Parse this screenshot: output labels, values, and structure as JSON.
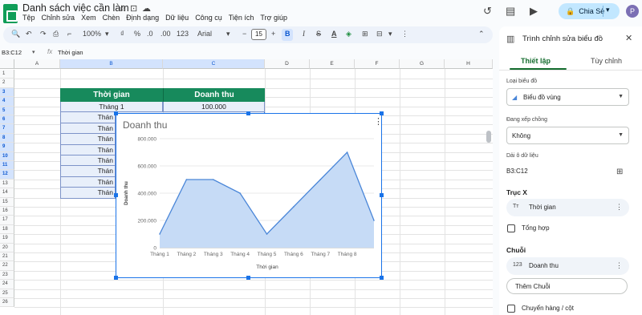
{
  "app": {
    "title": "Danh sách việc cần làm",
    "menu": [
      "Tệp",
      "Chỉnh sửa",
      "Xem",
      "Chèn",
      "Định dạng",
      "Dữ liệu",
      "Công cụ",
      "Tiện ích",
      "Trợ giúp"
    ],
    "share_label": "Chia Sẻ",
    "avatar_initial": "P"
  },
  "toolbar": {
    "zoom": "100%",
    "currency": "₫",
    "percent": "%",
    "decrease_decimal": ".0",
    "increase_decimal": ".00",
    "number_format": "123",
    "font": "Arial",
    "font_size": "15",
    "bold": "B",
    "italic": "I"
  },
  "formula_bar": {
    "name_box": "B3:C12",
    "fx": "fx",
    "value": "Thời gian"
  },
  "sheet": {
    "columns": [
      "A",
      "B",
      "C",
      "D",
      "E",
      "F",
      "G",
      "H"
    ],
    "rows": [
      "1",
      "2",
      "3",
      "4",
      "5",
      "6",
      "7",
      "8",
      "9",
      "10",
      "11",
      "12",
      "13",
      "14",
      "15",
      "16",
      "17",
      "18",
      "19",
      "20",
      "21",
      "22",
      "23",
      "24",
      "25",
      "26"
    ],
    "table_header": [
      "Thời gian",
      "Doanh thu"
    ],
    "visible_cells": {
      "b4": "Tháng 1",
      "c4": "100.000",
      "b5": "Thán",
      "b6": "Thán",
      "b7": "Thán",
      "b8": "Thán",
      "b9": "Thán",
      "b10": "Thán",
      "b11": "Thán",
      "b12": "Thán"
    }
  },
  "chart_data": {
    "type": "area",
    "title": "Doanh thu",
    "xlabel": "Thời gian",
    "ylabel": "Doanh thu",
    "categories": [
      "Tháng 1",
      "Tháng 2",
      "Tháng 3",
      "Tháng 4",
      "Tháng 5",
      "Tháng 6",
      "Tháng 7",
      "Tháng 8"
    ],
    "x_tick_labels": [
      "Tháng 1",
      "Tháng 2",
      "Tháng 3",
      "Tháng 4",
      "Tháng 5",
      "Tháng 6",
      "Tháng 7",
      "Tháng 8"
    ],
    "values": [
      100000,
      500000,
      500000,
      400000,
      100000,
      300000,
      500000,
      700000,
      200000
    ],
    "ylim": [
      0,
      800000
    ],
    "y_ticks": [
      0,
      200000,
      400000,
      600000,
      800000
    ],
    "y_tick_labels": [
      "0",
      "200.000",
      "400.000",
      "600.000",
      "800.000"
    ],
    "grid": true,
    "legend": "none",
    "fill_color": "#c6dbf6",
    "line_color": "#4a86d8"
  },
  "panel": {
    "title": "Trình chỉnh sửa biểu đồ",
    "tab_setup": "Thiết lập",
    "tab_customize": "Tùy chỉnh",
    "chart_type_label": "Loại biểu đồ",
    "chart_type_value": "Biểu đồ vùng",
    "stacking_label": "Đang xếp chồng",
    "stacking_value": "Không",
    "range_label": "Dải ô dữ liệu",
    "range_value": "B3:C12",
    "x_axis_label": "Trục X",
    "x_axis_value": "Thời gian",
    "aggregate_label": "Tổng hợp",
    "series_label": "Chuỗi",
    "series_value": "Doanh thu",
    "add_series_label": "Thêm Chuỗi",
    "switch_label": "Chuyển hàng / cột"
  }
}
